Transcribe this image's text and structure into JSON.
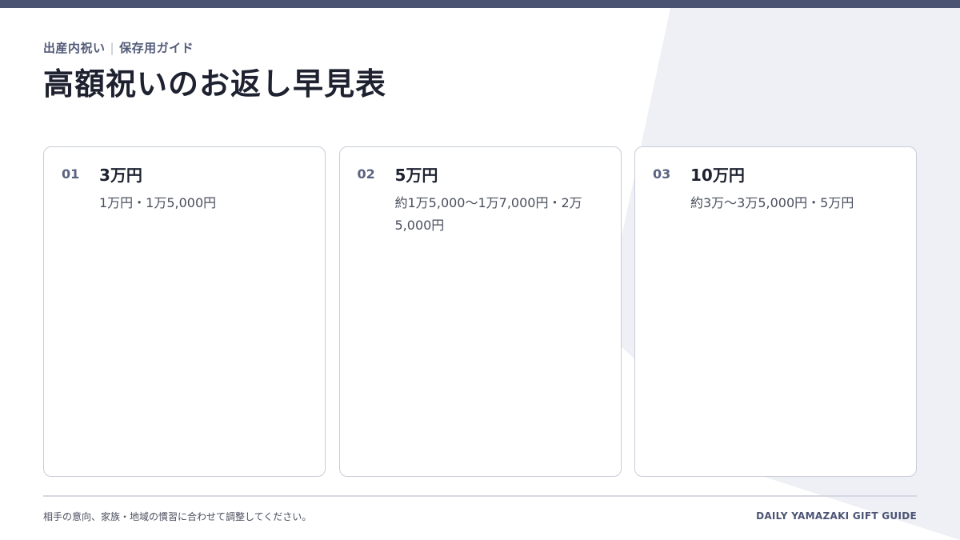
{
  "header": {
    "category": "出産内祝い",
    "separator": "|",
    "subcategory": "保存用ガイド",
    "title": "高額祝いのお返し早見表"
  },
  "cards": [
    {
      "number": "01",
      "amount": "3万円",
      "description": "1万円・1万5,000円"
    },
    {
      "number": "02",
      "amount": "5万円",
      "description": "約1万5,000〜1万7,000円・2万5,000円"
    },
    {
      "number": "03",
      "amount": "10万円",
      "description": "約3万〜3万5,000円・5万円"
    }
  ],
  "footer": {
    "note": "相手の意向、家族・地域の慣習に合わせて調整してください。",
    "brand": "DAILY YAMAZAKI GIFT GUIDE"
  },
  "colors": {
    "accent": "#4b5373",
    "background_shape": "#eef0f6",
    "card_border": "#c9ccd9"
  }
}
